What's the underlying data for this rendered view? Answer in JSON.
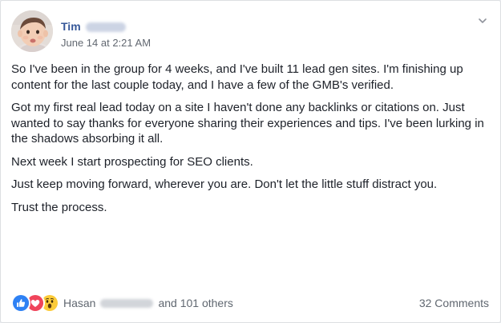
{
  "post": {
    "author_name": "Tim",
    "timestamp": "June 14 at 2:21 AM",
    "paragraphs": [
      "So I've been in the group for 4 weeks, and I've built 11 lead gen sites. I'm finishing up content for the last couple today, and I have a few of the GMB's verified.",
      "Got my first real lead today on a site I haven't done any backlinks or citations on. Just wanted to say thanks for everyone sharing their experiences and tips. I've been lurking in the shadows absorbing it all.",
      "Next week I start prospecting for SEO clients.",
      "Just keep moving forward, wherever you are. Don't let the little stuff distract you.",
      "Trust the process."
    ]
  },
  "reactions": {
    "icons": [
      "like-reaction-icon",
      "love-reaction-icon",
      "wow-reaction-icon"
    ],
    "colors": {
      "like": "#2e81f4",
      "love": "#f0445b",
      "wow": "#fccb39"
    },
    "first_name": "Hasan",
    "others_text": "and 101 others"
  },
  "comments": {
    "label": "32 Comments"
  },
  "colors": {
    "author": "#365899",
    "meta": "#616770",
    "text": "#1d2129"
  }
}
